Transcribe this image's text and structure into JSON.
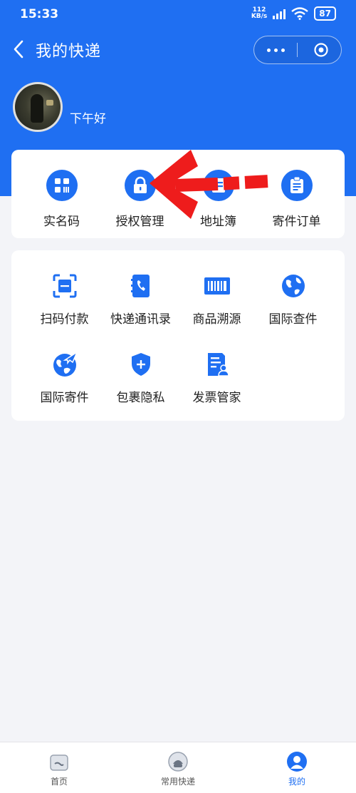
{
  "status": {
    "time": "15:33",
    "net_speed_value": "112",
    "net_speed_unit": "KB/s",
    "battery": "87"
  },
  "nav": {
    "title": "我的快递"
  },
  "profile": {
    "greeting": "下午好"
  },
  "quick_actions": [
    {
      "label": "实名码",
      "icon": "grid-qr-icon"
    },
    {
      "label": "授权管理",
      "icon": "lock-icon"
    },
    {
      "label": "地址簿",
      "icon": "address-book-icon"
    },
    {
      "label": "寄件订单",
      "icon": "clipboard-icon"
    }
  ],
  "services": [
    {
      "label": "扫码付款",
      "icon": "scan-icon"
    },
    {
      "label": "快递通讯录",
      "icon": "phone-book-icon"
    },
    {
      "label": "商品溯源",
      "icon": "barcode-icon"
    },
    {
      "label": "国际查件",
      "icon": "globe-icon"
    },
    {
      "label": "国际寄件",
      "icon": "globe-plane-icon"
    },
    {
      "label": "包裹隐私",
      "icon": "shield-icon"
    },
    {
      "label": "发票管家",
      "icon": "invoice-icon"
    }
  ],
  "tabs": [
    {
      "label": "首页",
      "icon": "home-box-icon"
    },
    {
      "label": "常用快递",
      "icon": "courier-icon"
    },
    {
      "label": "我的",
      "icon": "profile-icon",
      "active": true
    }
  ],
  "colors": {
    "primary": "#1f6ff2",
    "background": "#f3f4f8",
    "arrow": "#ee1c1c"
  }
}
